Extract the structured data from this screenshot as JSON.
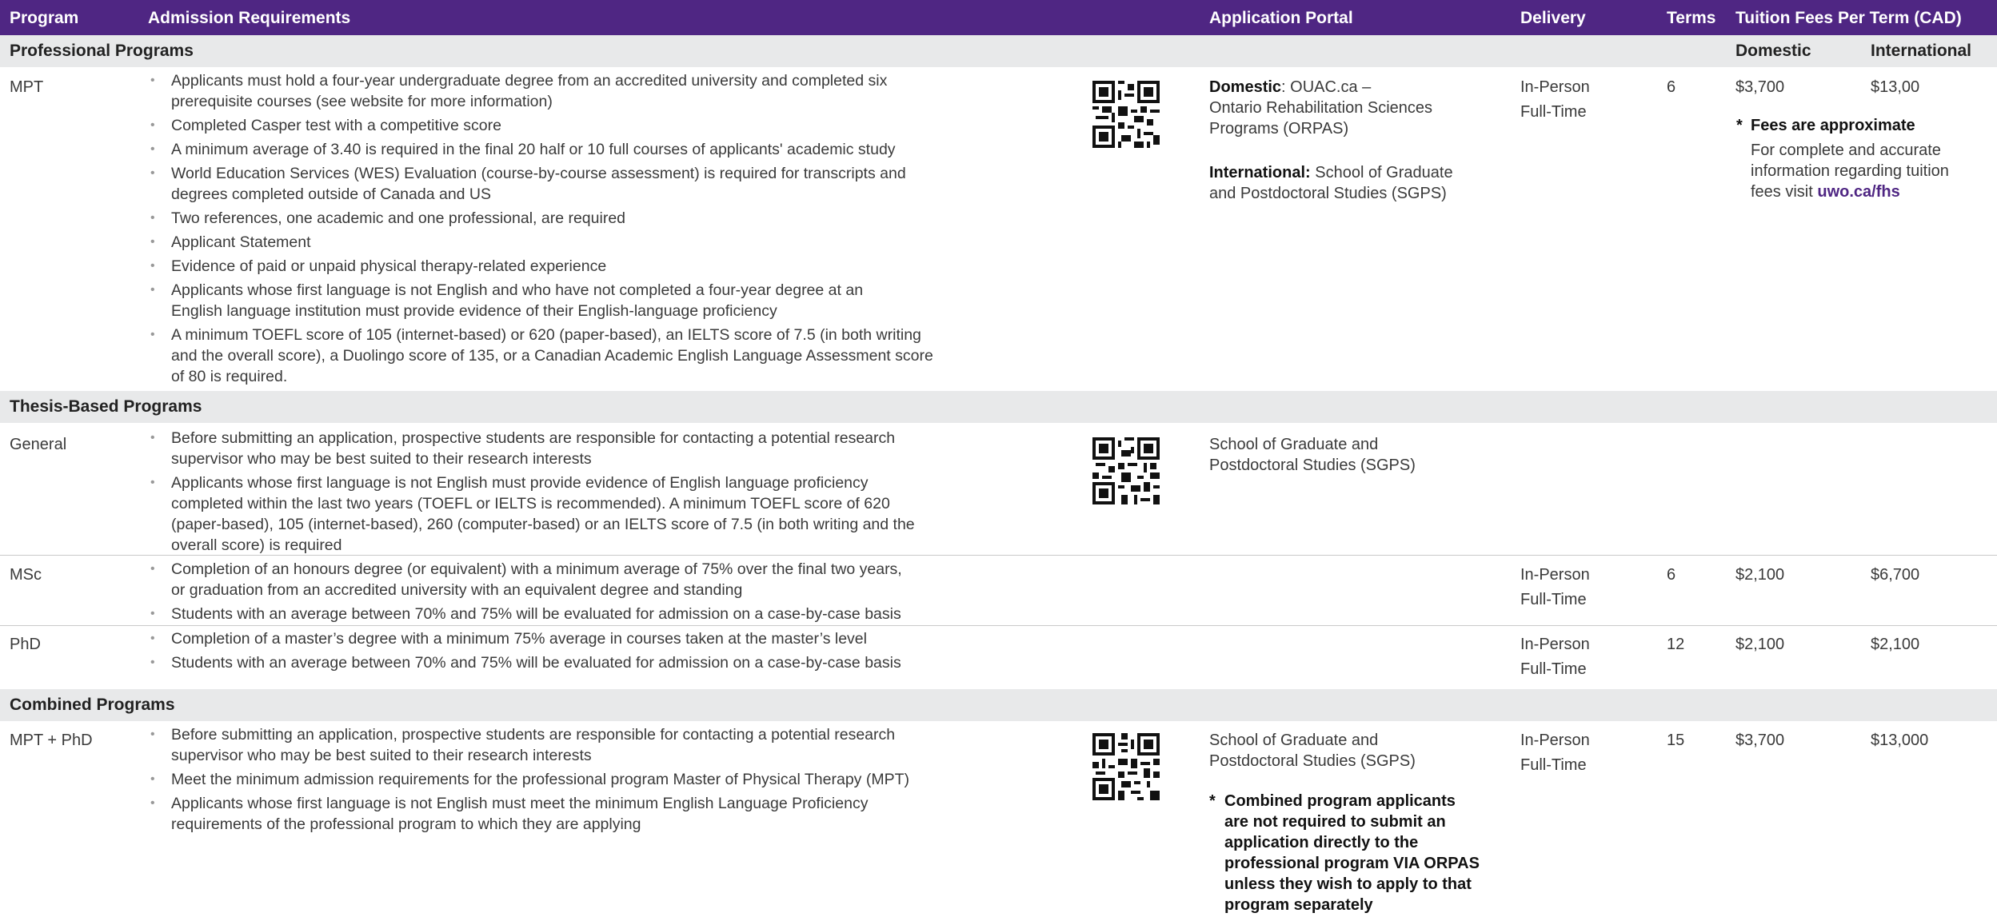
{
  "header": {
    "program": "Program",
    "admission": "Admission Requirements",
    "portal": "Application Portal",
    "delivery": "Delivery",
    "terms": "Terms",
    "fees": "Tuition Fees Per Term (CAD)"
  },
  "colors": {
    "header_bg": "#4f2683",
    "section_bg": "#e8e9ea",
    "link": "#4f2683"
  },
  "sections": {
    "professional": {
      "title": "Professional Programs",
      "domestic_label": "Domestic",
      "international_label": "International"
    },
    "thesis": {
      "title": "Thesis-Based Programs"
    },
    "combined": {
      "title": "Combined Programs"
    }
  },
  "rows": {
    "mpt": {
      "program": "MPT",
      "requirements": [
        "Applicants must hold a four-year undergraduate degree from an accredited university and completed six prerequisite courses (see website for more information)",
        "Completed Casper test with a competitive score",
        "A minimum average of 3.40 is required in the final 20 half or 10 full courses of applicants' academic study",
        "World Education Services (WES) Evaluation (course-by-course assessment) is required for transcripts and degrees completed outside of Canada and US",
        "Two references, one academic and one professional, are required",
        "Applicant Statement",
        "Evidence of paid or unpaid physical therapy-related experience",
        "Applicants whose first language is not English and who have not completed a four-year degree at an English language institution must provide evidence of their English-language proficiency",
        "A minimum TOEFL score of 105 (internet-based) or 620 (paper-based),  an IELTS score of 7.5 (in both writing and the overall score), a Duolingo score of 135, or a Canadian Academic English Language Assessment score of 80 is required."
      ],
      "portal": {
        "domestic_label": "Domestic",
        "domestic_line1": ": OUAC.ca –",
        "domestic_line2": "Ontario Rehabilitation Sciences",
        "domestic_line3": "Programs (ORPAS)",
        "international_label": "International:",
        "international_line1": " School of Graduate",
        "international_line2": "and Postdoctoral Studies (SGPS)"
      },
      "delivery_line1": "In-Person",
      "delivery_line2": "Full-Time",
      "terms": "6",
      "domestic_fee": "$3,700",
      "international_fee": "$13,00",
      "fee_note_title": "Fees are approximate",
      "fee_note_line1": "For complete and accurate",
      "fee_note_line2": "information regarding tuition",
      "fee_note_line3_prefix": "fees visit ",
      "fee_note_link": "uwo.ca/fhs"
    },
    "general": {
      "program": "General",
      "requirements": [
        "Before submitting an application, prospective students are responsible for contacting a potential research supervisor who may be best suited to their research interests",
        "Applicants whose first language is not English must provide evidence of English language proficiency completed within the last two years (TOEFL or IELTS is recommended). A minimum TOEFL score of 620 (paper-based), 105 (internet-based), 260 (computer-based) or an IELTS score of 7.5 (in both writing and the overall score) is required"
      ],
      "portal_line1": "School of Graduate and",
      "portal_line2": "Postdoctoral Studies (SGPS)"
    },
    "msc": {
      "program": "MSc",
      "requirements": [
        "Completion of an honours degree (or equivalent) with a minimum average of 75% over the final two years, or graduation from an accredited university with an equivalent degree and standing",
        "Students with an average between 70% and 75% will be evaluated for admission on a case-by-case basis"
      ],
      "delivery_line1": "In-Person",
      "delivery_line2": "Full-Time",
      "terms": "6",
      "domestic_fee": "$2,100",
      "international_fee": "$6,700"
    },
    "phd": {
      "program": "PhD",
      "requirements": [
        "Completion of a master’s degree with a minimum 75% average in courses taken at the master’s level",
        "Students with an average between 70% and 75% will be evaluated for admission on a case-by-case basis"
      ],
      "delivery_line1": "In-Person",
      "delivery_line2": "Full-Time",
      "terms": "12",
      "domestic_fee": "$2,100",
      "international_fee": "$2,100"
    },
    "mptphd": {
      "program": "MPT + PhD",
      "requirements": [
        "Before submitting an application, prospective students are responsible for contacting a potential research supervisor who may be best suited to their research interests",
        "Meet the minimum admission requirements for the professional program Master of Physical Therapy (MPT)",
        "Applicants whose first language is not English must meet the minimum English Language Proficiency requirements of the professional program to which they are applying"
      ],
      "portal_line1": "School of Graduate and",
      "portal_line2": "Postdoctoral Studies (SGPS)",
      "note_lines": [
        "Combined program applicants",
        "are not required to submit an",
        "application directly to the",
        "professional program VIA ORPAS",
        "unless they wish to apply to that",
        "program separately"
      ],
      "delivery_line1": "In-Person",
      "delivery_line2": "Full-Time",
      "terms": "15",
      "domestic_fee": "$3,700",
      "international_fee": "$13,000"
    }
  },
  "note_marker": "*",
  "icons": {
    "qr": "qr-code-icon"
  }
}
